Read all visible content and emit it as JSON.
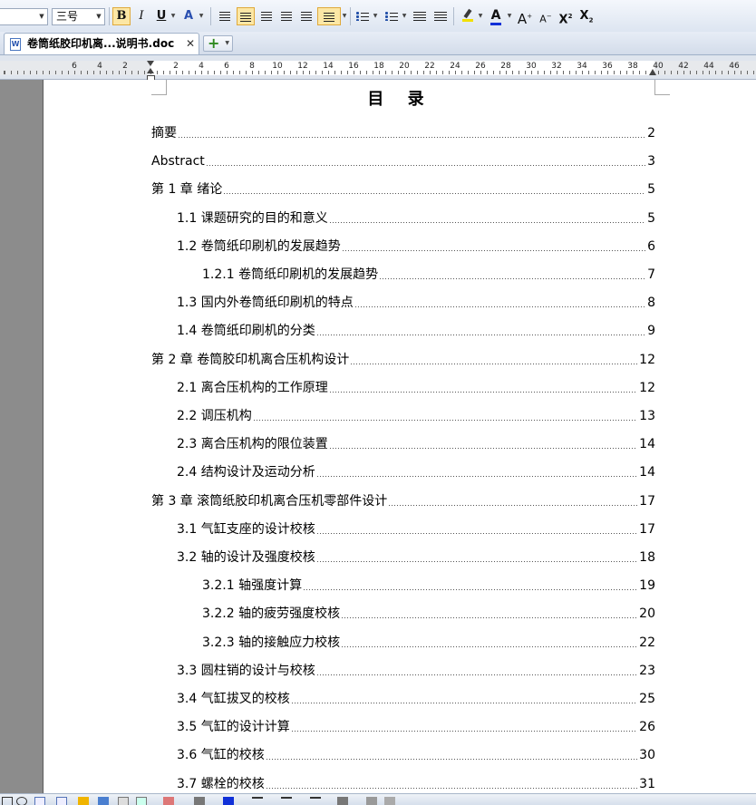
{
  "toolbar": {
    "font_name": "",
    "font_size": "三号",
    "bold": "B",
    "italic": "I",
    "underline": "U",
    "char_style": "A",
    "font_color": "A",
    "grow_font": "A",
    "shrink_font": "A",
    "superscript": "X",
    "subscript": "X",
    "superscript_mark": "2",
    "subscript_mark": "2"
  },
  "tabs": {
    "active_doc": "卷筒纸胶印机离...说明书.doc",
    "close": "✕",
    "new": "+"
  },
  "ruler": {
    "labels": [
      "6",
      "4",
      "2",
      "2",
      "4",
      "6",
      "8",
      "10",
      "12",
      "14",
      "16",
      "18",
      "20",
      "22",
      "24",
      "26",
      "28",
      "30",
      "32",
      "34",
      "36",
      "38",
      "40",
      "42",
      "44",
      "46"
    ]
  },
  "document": {
    "toc_title": "目 录",
    "entries": [
      {
        "text": "摘要",
        "page": "2",
        "level": 0
      },
      {
        "text": "Abstract",
        "page": "3",
        "level": 0
      },
      {
        "text": "第 1 章 绪论",
        "page": "5",
        "level": 0
      },
      {
        "text": "1.1 课题研究的目的和意义",
        "page": "5",
        "level": 1
      },
      {
        "text": "1.2 卷筒纸印刷机的发展趋势",
        "page": "6",
        "level": 1
      },
      {
        "text": "1.2.1 卷筒纸印刷机的发展趋势",
        "page": "7",
        "level": 2
      },
      {
        "text": "1.3 国内外卷筒纸印刷机的特点",
        "page": "8",
        "level": 1
      },
      {
        "text": "1.4 卷筒纸印刷机的分类",
        "page": "9",
        "level": 1
      },
      {
        "text": "第 2 章 卷筒胶印机离合压机构设计",
        "page": "12",
        "level": 0
      },
      {
        "text": "2.1 离合压机构的工作原理",
        "page": "12",
        "level": 1
      },
      {
        "text": "2.2 调压机构",
        "page": "13",
        "level": 1
      },
      {
        "text": "2.3 离合压机构的限位装置",
        "page": "14",
        "level": 1
      },
      {
        "text": "2.4 结构设计及运动分析",
        "page": "14",
        "level": 1
      },
      {
        "text": "第 3 章 滚筒纸胶印机离合压机零部件设计",
        "page": "17",
        "level": 0
      },
      {
        "text": "3.1 气缸支座的设计校核",
        "page": "17",
        "level": 1
      },
      {
        "text": "3.2 轴的设计及强度校核",
        "page": "18",
        "level": 1
      },
      {
        "text": "3.2.1 轴强度计算",
        "page": "19",
        "level": 2
      },
      {
        "text": "3.2.2 轴的疲劳强度校核",
        "page": "20",
        "level": 2
      },
      {
        "text": "3.2.3 轴的接触应力校核",
        "page": "22",
        "level": 2
      },
      {
        "text": "3.3 圆柱销的设计与校核",
        "page": "23",
        "level": 1
      },
      {
        "text": "3.4 气缸拔叉的校核",
        "page": "25",
        "level": 1
      },
      {
        "text": "3.5 气缸的设计计算",
        "page": "26",
        "level": 1
      },
      {
        "text": "3.6 气缸的校核",
        "page": "30",
        "level": 1
      },
      {
        "text": "3.7 螺栓的校核",
        "page": "31",
        "level": 1
      }
    ]
  },
  "colors": {
    "active_button": "#fce7a5",
    "font_color_bar": "#1030d8",
    "highlight_bar": "#f2e000",
    "canvas_gray": "#8c8c8c"
  }
}
